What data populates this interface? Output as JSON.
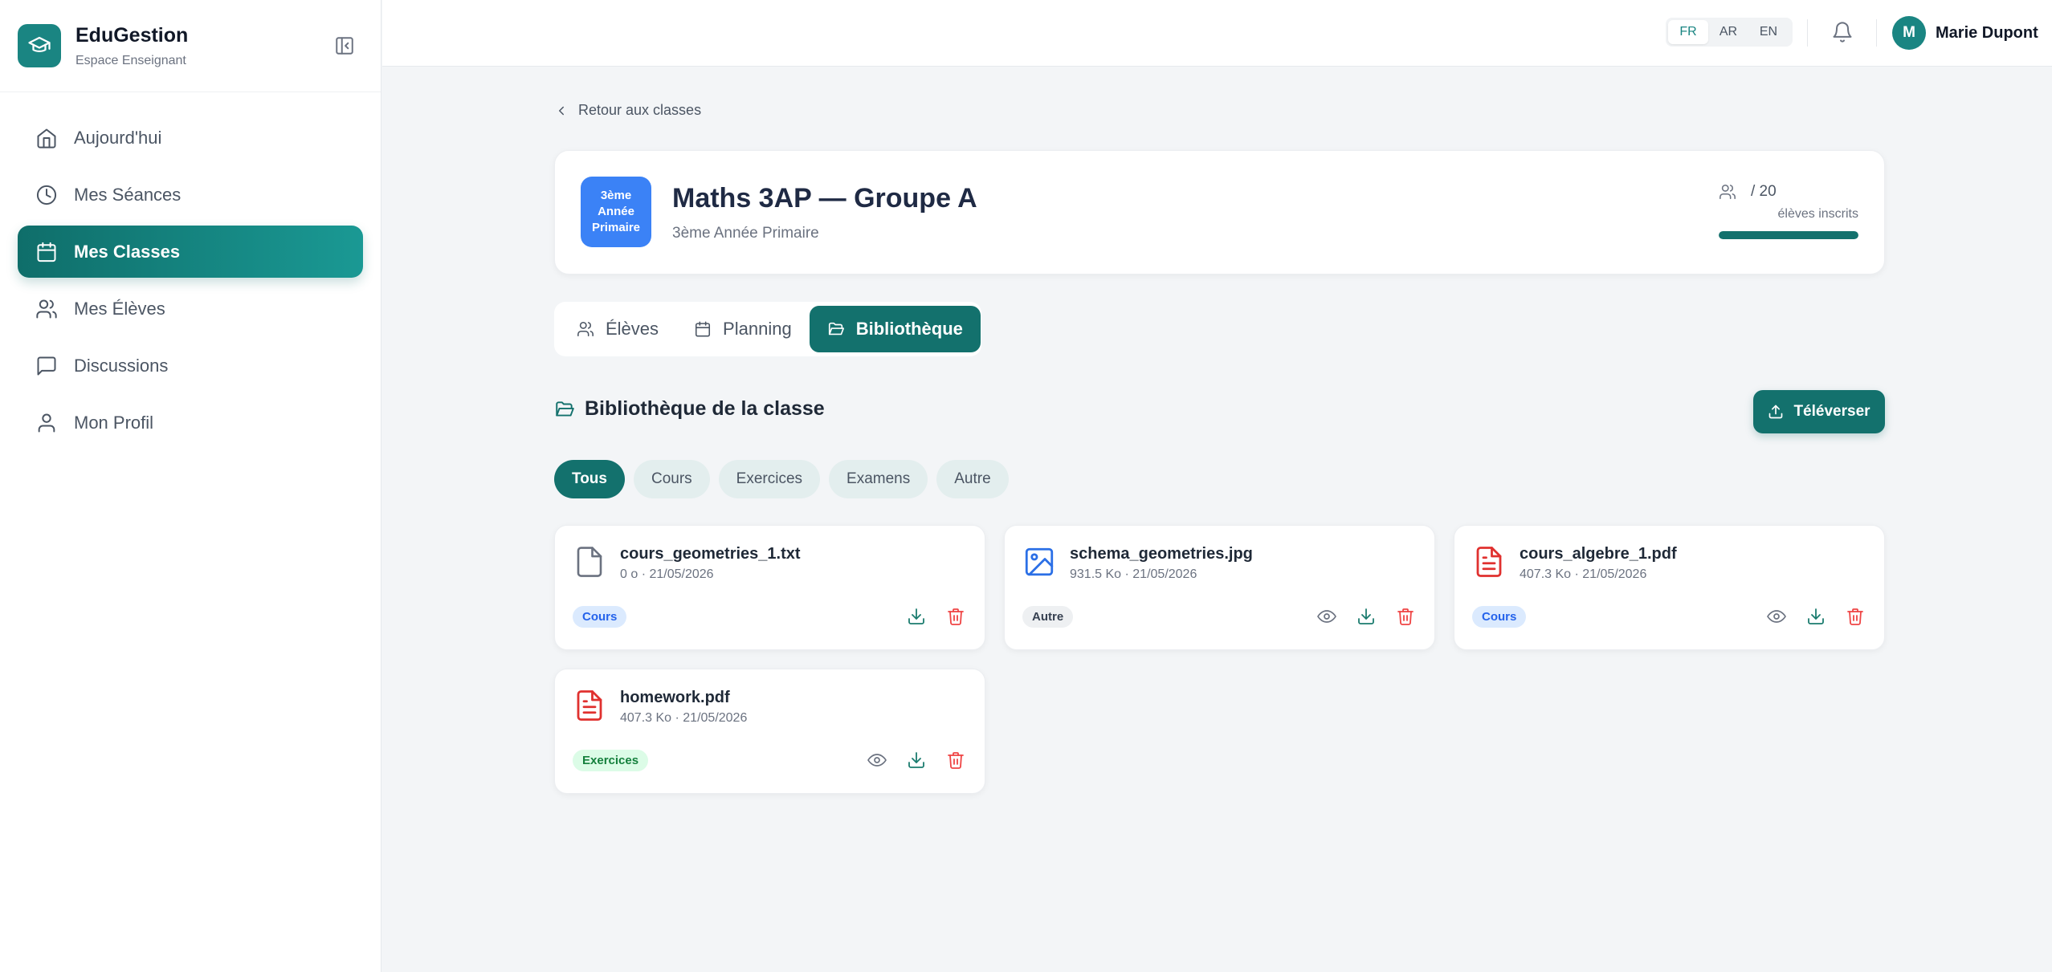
{
  "colors": {
    "primary": "#13716d",
    "brand": "#1a8582",
    "class_badge": "#3b82f6",
    "pdf_red": "#e0312f",
    "image_blue": "#2b6fe6",
    "download_green": "#1b7c6f",
    "delete_red": "#ef4444"
  },
  "sidebar": {
    "brand_name": "EduGestion",
    "brand_sub": "Espace Enseignant",
    "items": [
      {
        "label": "Aujourd'hui",
        "icon": "home-icon",
        "active": false
      },
      {
        "label": "Mes Séances",
        "icon": "clock-icon",
        "active": false
      },
      {
        "label": "Mes Classes",
        "icon": "calendar-icon",
        "active": true
      },
      {
        "label": "Mes Élèves",
        "icon": "users-icon",
        "active": false
      },
      {
        "label": "Discussions",
        "icon": "chat-icon",
        "active": false
      },
      {
        "label": "Mon Profil",
        "icon": "user-icon",
        "active": false
      }
    ]
  },
  "topbar": {
    "languages": [
      "FR",
      "AR",
      "EN"
    ],
    "active_language": "FR",
    "user_initial": "M",
    "user_name": "Marie Dupont"
  },
  "main": {
    "back_label": "Retour aux classes",
    "class": {
      "badge": "3ème Année Primaire",
      "title": "Maths 3AP — Groupe A",
      "subtitle": "3ème Année Primaire",
      "enrolled": "/ 20",
      "enrolled_label": "élèves inscrits",
      "enrolled_fill": 1.0
    },
    "tabs": [
      {
        "label": "Élèves",
        "icon": "users-icon",
        "active": false
      },
      {
        "label": "Planning",
        "icon": "calendar-icon",
        "active": false
      },
      {
        "label": "Bibliothèque",
        "icon": "folder-icon",
        "active": true
      }
    ],
    "library": {
      "title": "Bibliothèque de la classe",
      "upload_label": "Téléverser",
      "filters": [
        "Tous",
        "Cours",
        "Exercices",
        "Examens",
        "Autre"
      ],
      "active_filter": "Tous",
      "files": [
        {
          "name": "cours_geometries_1.txt",
          "meta": "0 o · 21/05/2026",
          "tag": "Cours",
          "icon": "text-file-icon",
          "preview": false
        },
        {
          "name": "schema_geometries.jpg",
          "meta": "931.5 Ko · 21/05/2026",
          "tag": "Autre",
          "icon": "image-file-icon",
          "preview": true
        },
        {
          "name": "cours_algebre_1.pdf",
          "meta": "407.3 Ko · 21/05/2026",
          "tag": "Cours",
          "icon": "pdf-file-icon",
          "preview": true
        },
        {
          "name": "homework.pdf",
          "meta": "407.3 Ko · 21/05/2026",
          "tag": "Exercices",
          "icon": "pdf-file-icon",
          "preview": true
        }
      ]
    }
  }
}
